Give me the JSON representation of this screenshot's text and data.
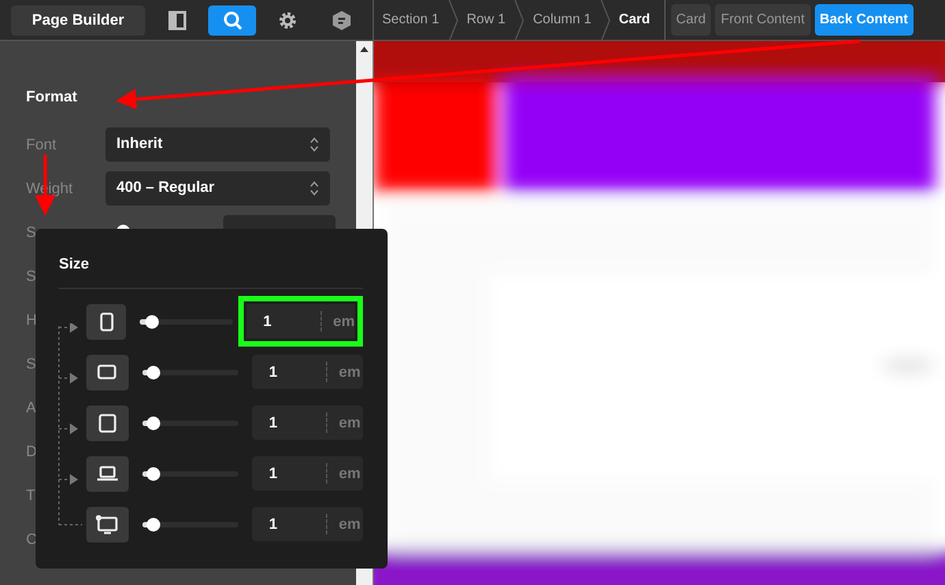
{
  "toolbar": {
    "title": "Page Builder",
    "tools": [
      {
        "kind": "panel",
        "selected": false
      },
      {
        "kind": "search",
        "selected": true
      },
      {
        "kind": "settings",
        "selected": false
      },
      {
        "kind": "hexagon",
        "selected": false
      }
    ]
  },
  "breadcrumbs": [
    {
      "label": "Section 1",
      "selected": false
    },
    {
      "label": "Row 1",
      "selected": false
    },
    {
      "label": "Column 1",
      "selected": false
    },
    {
      "label": "Card",
      "selected": true
    }
  ],
  "element_tabs": [
    {
      "label": "Card",
      "selected": false
    },
    {
      "label": "Front Content",
      "selected": false
    },
    {
      "label": "Back Content",
      "selected": true
    }
  ],
  "panel": {
    "heading": "Format",
    "fields": [
      {
        "kind": "select",
        "label": "Font",
        "value": "Inherit"
      },
      {
        "kind": "select",
        "label": "Weight",
        "value": "400 – Regular"
      },
      {
        "kind": "slider",
        "label": "S",
        "level": 0.12
      },
      {
        "kind": "label",
        "label": "S"
      },
      {
        "kind": "label",
        "label": "H"
      },
      {
        "kind": "label",
        "label": "S"
      },
      {
        "kind": "label",
        "label": "A"
      },
      {
        "kind": "label",
        "label": "D"
      },
      {
        "kind": "label",
        "label": "T"
      },
      {
        "kind": "label",
        "label": "C"
      }
    ]
  },
  "size_popup": {
    "title": "Size",
    "rows": [
      {
        "kind": "phone",
        "level": 0.12,
        "value": "1",
        "unit": "em",
        "highlighted": true
      },
      {
        "kind": "tablet-landscape",
        "level": 0.12,
        "value": "1",
        "unit": "em",
        "highlighted": false
      },
      {
        "kind": "tablet",
        "level": 0.12,
        "value": "1",
        "unit": "em",
        "highlighted": false
      },
      {
        "kind": "laptop",
        "level": 0.12,
        "value": "1",
        "unit": "em",
        "highlighted": false
      },
      {
        "kind": "desktop",
        "level": 0.12,
        "value": "1",
        "unit": "em",
        "highlighted": false
      }
    ]
  }
}
